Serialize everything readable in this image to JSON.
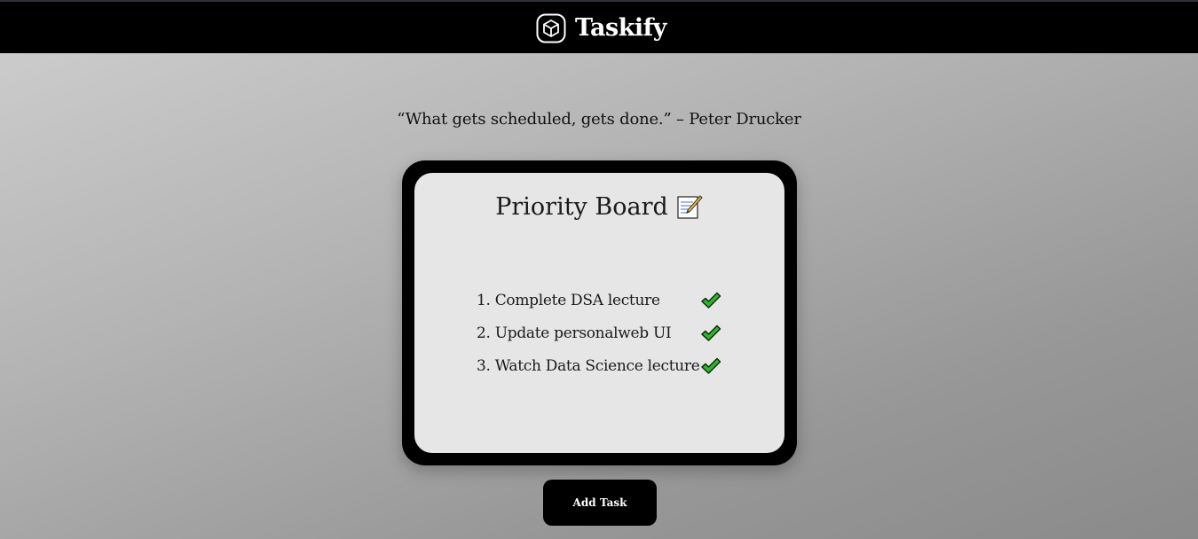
{
  "header": {
    "brand_name": "Taskify",
    "brand_icon": "cube-icon"
  },
  "quote": {
    "text": "“What gets scheduled, gets done.” – Peter Drucker"
  },
  "board": {
    "title": "Priority Board",
    "title_icon": "memo-icon",
    "tasks": [
      {
        "label": "1. Complete DSA lecture",
        "done": true
      },
      {
        "label": "2. Update personalweb UI",
        "done": true
      },
      {
        "label": "3. Watch Data Science lecture",
        "done": true
      }
    ]
  },
  "actions": {
    "add_task_label": "Add Task"
  },
  "colors": {
    "header_bg": "#000000",
    "board_bg": "#e6e6e6",
    "check_green": "#2fb52f"
  }
}
